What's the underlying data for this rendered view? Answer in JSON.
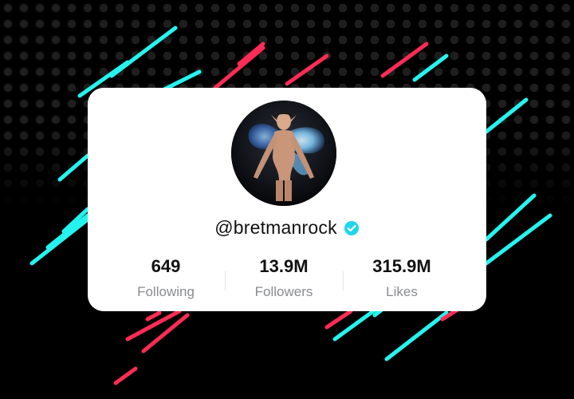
{
  "profile": {
    "handle": "@bretmanrock",
    "verified": true
  },
  "stats": [
    {
      "value": "649",
      "label": "Following"
    },
    {
      "value": "13.9M",
      "label": "Followers"
    },
    {
      "value": "315.9M",
      "label": "Likes"
    }
  ],
  "colors": {
    "accent_cyan": "#25f4ee",
    "accent_red": "#fe2c55",
    "verified_blue": "#20d5ec",
    "background": "#000000"
  }
}
